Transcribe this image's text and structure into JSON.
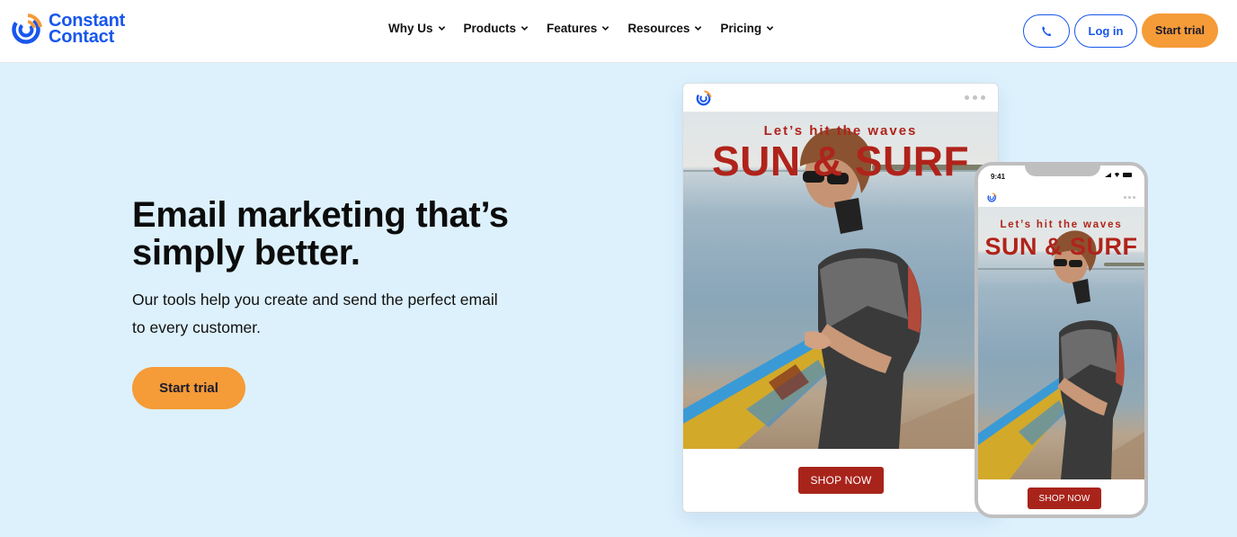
{
  "brand": {
    "name_line1": "Constant",
    "name_line2": "Contact",
    "primary_color": "#1856ed",
    "accent_color": "#f59b37",
    "logo_icon": "constant-contact-logo-icon"
  },
  "nav": {
    "items": [
      {
        "label": "Why Us",
        "icon": "chevron-down-icon"
      },
      {
        "label": "Products",
        "icon": "chevron-down-icon"
      },
      {
        "label": "Features",
        "icon": "chevron-down-icon"
      },
      {
        "label": "Resources",
        "icon": "chevron-down-icon"
      },
      {
        "label": "Pricing",
        "icon": "chevron-down-icon"
      }
    ],
    "phone_icon": "phone-icon",
    "login_label": "Log in",
    "start_trial_label": "Start trial"
  },
  "hero": {
    "title": "Email marketing that’s simply better.",
    "subtitle": "Our tools help you create and send the perfect email to every customer.",
    "cta_label": "Start trial",
    "background_color": "#ddf1fd"
  },
  "email_preview": {
    "tagline": "Let’s hit the waves",
    "headline": "SUN & SURF",
    "button_label": "SHOP NOW",
    "brand_red": "#a8241b",
    "menu_icon": "more-dots-icon"
  },
  "phone_preview": {
    "status_time": "9:41",
    "status_icons": [
      "signal-icon",
      "wifi-icon",
      "battery-icon"
    ],
    "tagline": "Let’s hit the waves",
    "headline": "SUN & SURF",
    "button_label": "SHOP NOW"
  }
}
